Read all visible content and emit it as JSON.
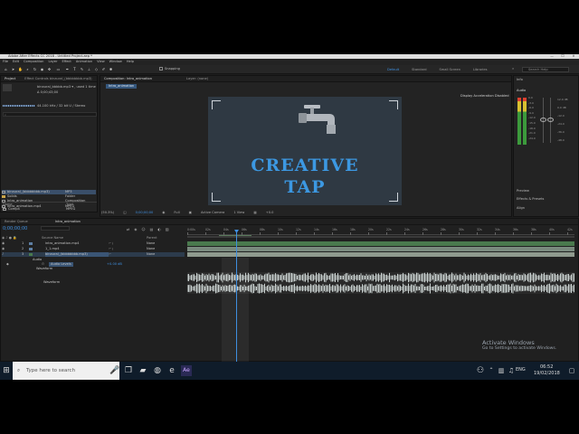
{
  "app": {
    "title": "Adobe After Effects CC 2018 - Untitled Project.aep *",
    "menu": [
      "File",
      "Edit",
      "Composition",
      "Layer",
      "Effect",
      "Animation",
      "View",
      "Window",
      "Help"
    ],
    "window_buttons": [
      "—",
      "☐",
      "✕"
    ]
  },
  "toolbar": {
    "snapping_label": "Snapping",
    "workspaces": [
      "Default",
      "Standard",
      "Small Screen",
      "Libraries"
    ],
    "active_workspace": "Default",
    "search_placeholder": "Search Help"
  },
  "project_panel": {
    "tabs": [
      "Project",
      "Effect Controls binaural_(bbbbbbbb.mp3)"
    ],
    "preview_name": "binaural_bbbbb.mp3 ▾ , used 1 time",
    "preview_dur": "Δ 0;00;43;00",
    "preview_meta": "44.100 kHz / 32 bit U / Stereo",
    "search_icon": "⌕",
    "col_name": "Name",
    "col_type": "Type",
    "items": [
      {
        "name": "Comp4",
        "type": "MPEG",
        "icon": "file-icon"
      },
      {
        "name": "binaural_(bbbbbbbb.mp3)",
        "type": "MP3",
        "icon": "audio-file-icon"
      },
      {
        "name": "Solids",
        "type": "Folder",
        "icon": "folder-icon"
      },
      {
        "name": "Intro_animation",
        "type": "Composition",
        "icon": "composition-icon"
      },
      {
        "name": "intro_animation.mp4",
        "type": "MPEG",
        "icon": "file-icon"
      }
    ],
    "bpc": "8 bpc"
  },
  "composition_panel": {
    "tabs": [
      "Composition: Intro_animation",
      "Layer: (none)"
    ],
    "comp_tab_chip": "Intro_animation",
    "acceleration_notice": "Display Acceleration Disabled",
    "title_line1": "CREATIVE",
    "title_line2": "TAP",
    "logo_icon": "faucet-icon",
    "zoom": "(50.3%)",
    "timecode": "0;00;00;00",
    "resolution": "Full",
    "camera": "Active Camera",
    "views": "1 View",
    "offset": "+0.0"
  },
  "right_panels": {
    "info": "Info",
    "audio": "Audio",
    "audio_scale_left": [
      "0.0",
      "-3.0",
      "-6.0",
      "-9.0",
      "-12.0",
      "-15.0",
      "-18.0",
      "-21.0",
      "-24.0"
    ],
    "audio_scale_right": [
      "12.0 dB",
      "0.0 dB",
      "-12.0",
      "-24.0",
      "-36.0",
      "-48.0"
    ],
    "preview": "Preview",
    "effects": "Effects & Presets",
    "align": "Align"
  },
  "timeline": {
    "tabs": [
      "Render Queue",
      "Intro_animation"
    ],
    "timecode": "0;00;00;00",
    "header_source": "Source Name",
    "header_parent": "Parent",
    "layers": [
      {
        "num": "1",
        "name": "intro_animation.mp4",
        "parent": "None"
      },
      {
        "num": "2",
        "name": "1_1.mp4",
        "parent": "None"
      },
      {
        "num": "3",
        "name": "binaural_(bbbbbbbb.mp3)",
        "parent": "None"
      }
    ],
    "audio_label": "Audio",
    "audio_levels_label": "Audio Levels",
    "audio_levels_value": "+0.00 dB",
    "waveform_label": "Waveform",
    "waveform_sub": "Waveform",
    "toggle_label": "Toggle Switches / Modes",
    "ruler": [
      "0:00s",
      "02s",
      "04s",
      "06s",
      "08s",
      "10s",
      "12s",
      "14s",
      "16s",
      "18s",
      "20s",
      "22s",
      "24s",
      "26s",
      "28s",
      "30s",
      "32s",
      "34s",
      "36s",
      "38s",
      "40s",
      "42s"
    ]
  },
  "activate_windows": {
    "line1": "Activate Windows",
    "line2": "Go to Settings to activate Windows."
  },
  "taskbar": {
    "search_placeholder": "Type here to search",
    "time": "06:52",
    "date": "19/02/2018",
    "lang": "ENG"
  },
  "colors": {
    "accent": "#3f8fe0",
    "title_blue": "#3c98e2",
    "viewer_bg": "#2f3943",
    "waveform": "#c8d0cf",
    "layer_green": "#4a7a4e"
  }
}
